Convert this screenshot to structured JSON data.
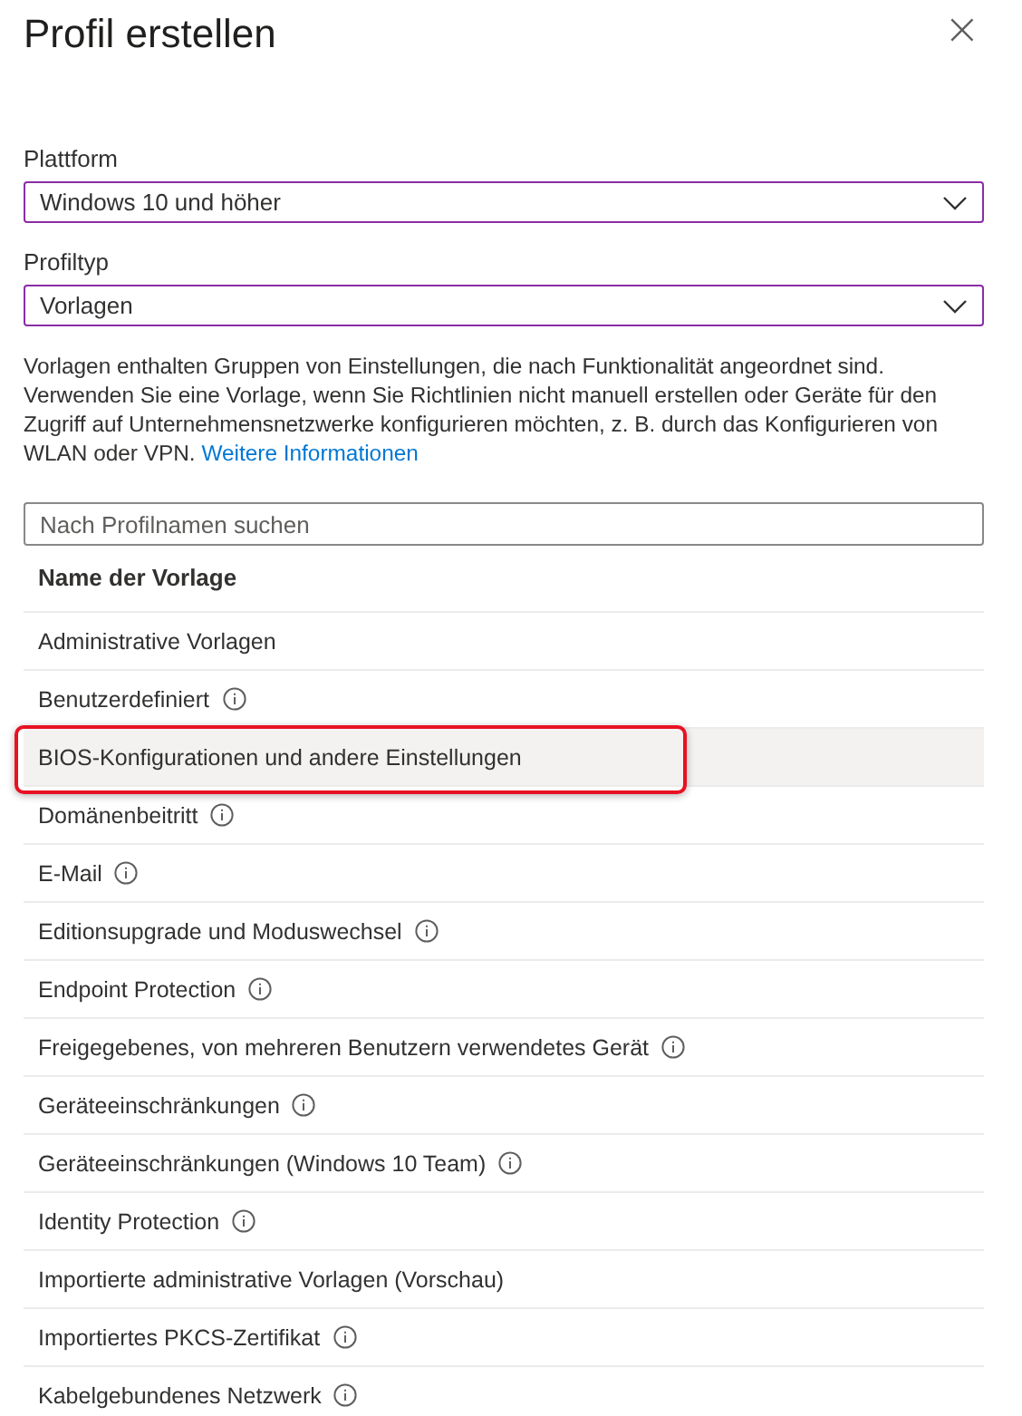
{
  "panel": {
    "title": "Profil erstellen",
    "close": "×"
  },
  "fields": [
    {
      "label": "Plattform",
      "value": "Windows 10 und höher"
    },
    {
      "label": "Profiltyp",
      "value": "Vorlagen"
    }
  ],
  "description": {
    "text": "Vorlagen enthalten Gruppen von Einstellungen, die nach Funktionalität angeordnet sind. Verwenden Sie eine Vorlage, wenn Sie Richtlinien nicht manuell erstellen oder Geräte für den Zugriff auf Unternehmensnetzwerke konfigurieren möchten, z. B. durch das Konfigurieren von WLAN oder VPN.",
    "link": "Weitere Informationen"
  },
  "search": {
    "placeholder": "Nach Profilnamen suchen"
  },
  "table": {
    "columns": [
      "Name der Vorlage"
    ],
    "rows": [
      {
        "name": "Administrative Vorlagen",
        "info": false,
        "selected": false,
        "highlighted": false
      },
      {
        "name": "Benutzerdefiniert",
        "info": true,
        "selected": false,
        "highlighted": false
      },
      {
        "name": "BIOS-Konfigurationen und andere Einstellungen",
        "info": false,
        "selected": true,
        "highlighted": true
      },
      {
        "name": "Domänenbeitritt",
        "info": true,
        "selected": false,
        "highlighted": false
      },
      {
        "name": "E-Mail",
        "info": true,
        "selected": false,
        "highlighted": false
      },
      {
        "name": "Editionsupgrade und Moduswechsel",
        "info": true,
        "selected": false,
        "highlighted": false
      },
      {
        "name": "Endpoint Protection",
        "info": true,
        "selected": false,
        "highlighted": false
      },
      {
        "name": "Freigegebenes, von mehreren Benutzern verwendetes Gerät",
        "info": true,
        "selected": false,
        "highlighted": false
      },
      {
        "name": "Geräteeinschränkungen",
        "info": true,
        "selected": false,
        "highlighted": false
      },
      {
        "name": "Geräteeinschränkungen (Windows 10 Team)",
        "info": true,
        "selected": false,
        "highlighted": false
      },
      {
        "name": "Identity Protection",
        "info": true,
        "selected": false,
        "highlighted": false
      },
      {
        "name": "Importierte administrative Vorlagen (Vorschau)",
        "info": false,
        "selected": false,
        "highlighted": false
      },
      {
        "name": "Importiertes PKCS-Zertifikat",
        "info": true,
        "selected": false,
        "highlighted": false
      },
      {
        "name": "Kabelgebundenes Netzwerk",
        "info": true,
        "selected": false,
        "highlighted": false
      }
    ]
  }
}
